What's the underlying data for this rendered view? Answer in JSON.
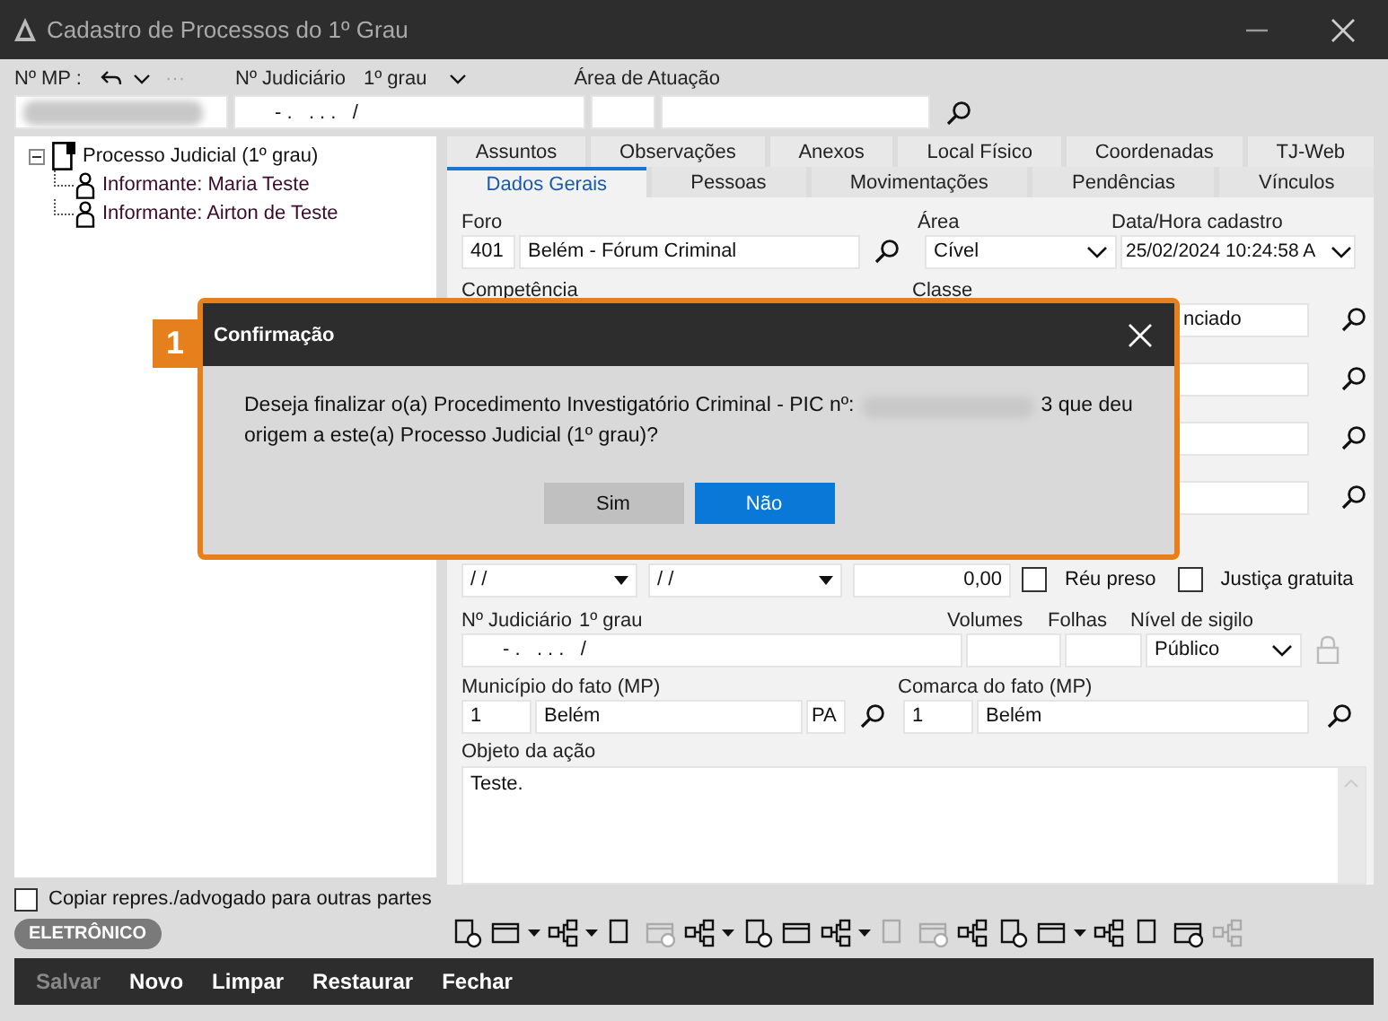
{
  "window": {
    "title": "Cadastro de Processos do 1º Grau"
  },
  "header": {
    "mp_label": "Nº MP :",
    "mp_more": "···",
    "judiciario_label": "Nº Judiciário",
    "judiciario_grau": "1º grau",
    "judiciario_value": "- .   . . .   /",
    "area_label": "Área de Atuação"
  },
  "tree": [
    {
      "label": "Processo Judicial (1º grau)",
      "expanded": true,
      "children": [
        {
          "label": "Informante: Maria Teste"
        },
        {
          "label": "Informante: Airton de Teste"
        }
      ]
    }
  ],
  "copy_checkbox": {
    "label": "Copiar repres./advogado para outras partes",
    "checked": false
  },
  "badge": "ELETRÔNICO",
  "tabs_row1": [
    {
      "label": "Assuntos",
      "selected": false
    },
    {
      "label": "Observações",
      "selected": false
    },
    {
      "label": "Anexos",
      "selected": false
    },
    {
      "label": "Local Físico",
      "selected": false
    },
    {
      "label": "Coordenadas",
      "selected": false
    },
    {
      "label": "TJ-Web",
      "selected": false
    }
  ],
  "tabs_row2": [
    {
      "label": "Dados Gerais",
      "selected": true
    },
    {
      "label": "Pessoas",
      "selected": false
    },
    {
      "label": "Movimentações",
      "selected": false
    },
    {
      "label": "Pendências",
      "selected": false
    },
    {
      "label": "Vínculos",
      "selected": false
    }
  ],
  "form": {
    "foro": {
      "label": "Foro",
      "code": "401",
      "name": "Belém - Fórum Criminal"
    },
    "area": {
      "label": "Área",
      "value": "Cível"
    },
    "data_cadastro": {
      "label": "Data/Hora cadastro",
      "value": "25/02/2024 10:24:58 A"
    },
    "competencia_label": "Competência",
    "classe": {
      "label": "Classe",
      "value": "nciado"
    },
    "dates": [
      "/  /",
      "/  /"
    ],
    "valor": "0,00",
    "reu_preso": {
      "label": "Réu preso",
      "checked": false
    },
    "justica_gratuita": {
      "label": "Justiça gratuita",
      "checked": false
    },
    "judiciario": {
      "label": "Nº Judiciário",
      "grau": "1º grau",
      "value": "- .   . . .   /"
    },
    "volumes_label": "Volumes",
    "folhas_label": "Folhas",
    "sigilo": {
      "label": "Nível de sigilo",
      "value": "Público"
    },
    "municipio": {
      "label": "Município do fato (MP)",
      "code": "1",
      "name": "Belém",
      "uf": "PA"
    },
    "comarca": {
      "label": "Comarca do fato (MP)",
      "code": "1",
      "name": "Belém"
    },
    "objeto": {
      "label": "Objeto da ação",
      "value": "Teste."
    }
  },
  "dialog": {
    "step": "1",
    "title": "Confirmação",
    "message_start": "Deseja finalizar o(a) Procedimento Investigatório Criminal - PIC nº:",
    "message_after_redaction": "3 que deu",
    "message_line2": "origem a este(a) Processo Judicial (1º grau)?",
    "buttons": [
      {
        "label": "Sim",
        "selected": false
      },
      {
        "label": "Não",
        "selected": true
      }
    ]
  },
  "toolbar": [
    {
      "disabled": false,
      "dropdown": false
    },
    {
      "disabled": false,
      "dropdown": true
    },
    {
      "disabled": false,
      "dropdown": true
    },
    {
      "disabled": false,
      "dropdown": false
    },
    {
      "disabled": true,
      "dropdown": false
    },
    {
      "disabled": false,
      "dropdown": true
    },
    {
      "disabled": false,
      "dropdown": false
    },
    {
      "disabled": false,
      "dropdown": false
    },
    {
      "disabled": false,
      "dropdown": true
    },
    {
      "disabled": true,
      "dropdown": false
    },
    {
      "disabled": true,
      "dropdown": false
    },
    {
      "disabled": false,
      "dropdown": false
    },
    {
      "disabled": false,
      "dropdown": false
    },
    {
      "disabled": false,
      "dropdown": true
    },
    {
      "disabled": false,
      "dropdown": false
    },
    {
      "disabled": false,
      "dropdown": false
    },
    {
      "disabled": false,
      "dropdown": false
    },
    {
      "disabled": true,
      "dropdown": false
    }
  ],
  "actions": [
    {
      "label": "Salvar",
      "disabled": true
    },
    {
      "label": "Novo",
      "disabled": false
    },
    {
      "label": "Limpar",
      "disabled": false
    },
    {
      "label": "Restaurar",
      "disabled": false
    },
    {
      "label": "Fechar",
      "disabled": false
    }
  ]
}
